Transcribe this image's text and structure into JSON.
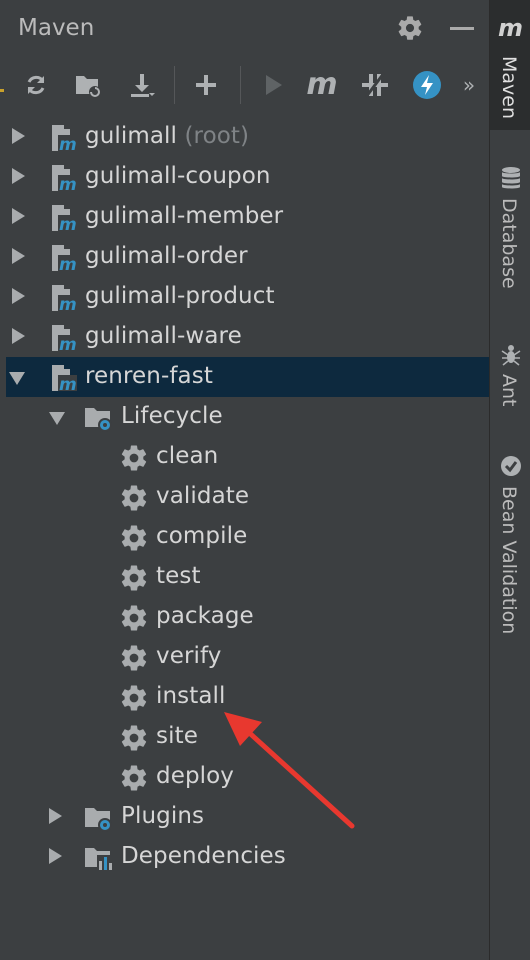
{
  "panel": {
    "title": "Maven"
  },
  "toolbar": {
    "buttons": [
      {
        "icon": "refresh-icon"
      },
      {
        "icon": "generate-sources-icon"
      },
      {
        "icon": "download-icon"
      },
      {
        "icon": "add-icon"
      },
      {
        "icon": "run-icon"
      },
      {
        "icon": "maven-goal-icon"
      },
      {
        "icon": "skip-tests-icon"
      },
      {
        "icon": "offline-lightning-icon"
      },
      {
        "icon": "more-chevrons-icon"
      }
    ]
  },
  "tree": {
    "projects": [
      {
        "name": "gulimall",
        "suffix": "(root)"
      },
      {
        "name": "gulimall-coupon",
        "suffix": ""
      },
      {
        "name": "gulimall-member",
        "suffix": ""
      },
      {
        "name": "gulimall-order",
        "suffix": ""
      },
      {
        "name": "gulimall-product",
        "suffix": ""
      },
      {
        "name": "gulimall-ware",
        "suffix": ""
      },
      {
        "name": "renren-fast",
        "suffix": ""
      }
    ],
    "lifecycle": {
      "label": "Lifecycle",
      "goals": [
        "clean",
        "validate",
        "compile",
        "test",
        "package",
        "verify",
        "install",
        "site",
        "deploy"
      ]
    },
    "plugins": "Plugins",
    "dependencies": "Dependencies"
  },
  "rightbar": {
    "maven": "Maven",
    "database": "Database",
    "ant": "Ant",
    "bean_validation": "Bean Validation"
  },
  "colors": {
    "panel_bg": "#3c3f41",
    "selection_bg": "#0d293e",
    "maven_blue": "#3592c4",
    "annotation_arrow": "#e8382f"
  }
}
